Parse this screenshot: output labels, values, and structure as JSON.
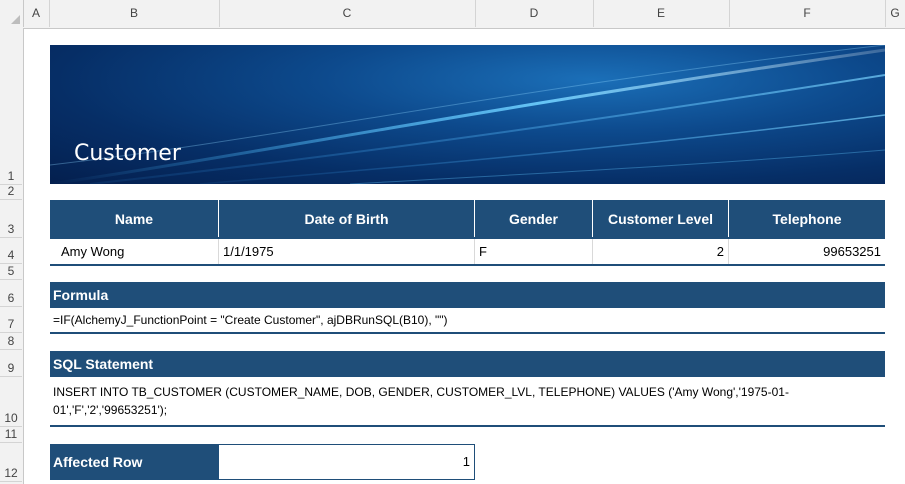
{
  "columns": [
    "A",
    "B",
    "C",
    "D",
    "E",
    "F",
    "G"
  ],
  "rows": [
    "1",
    "2",
    "3",
    "4",
    "5",
    "6",
    "7",
    "8",
    "9",
    "10",
    "11",
    "12"
  ],
  "banner": {
    "title": "Customer"
  },
  "customer_table": {
    "headers": [
      "Name",
      "Date of Birth",
      "Gender",
      "Customer Level",
      "Telephone"
    ],
    "row": [
      "Amy Wong",
      "1/1/1975",
      "F",
      "2",
      "99653251"
    ]
  },
  "formula": {
    "label": "Formula",
    "text": "=IF(AlchemyJ_FunctionPoint = \"Create Customer\", ajDBRunSQL(B10), \"\")"
  },
  "sql": {
    "label": "SQL Statement",
    "text": "INSERT INTO TB_CUSTOMER (CUSTOMER_NAME, DOB, GENDER, CUSTOMER_LVL, TELEPHONE) VALUES ('Amy Wong','1975-01-01','F','2','99653251');"
  },
  "affected": {
    "label": "Affected Row",
    "value": "1"
  },
  "colors": {
    "header_bg": "#1f4e79",
    "grid_header_bg": "#f2f2f2"
  }
}
